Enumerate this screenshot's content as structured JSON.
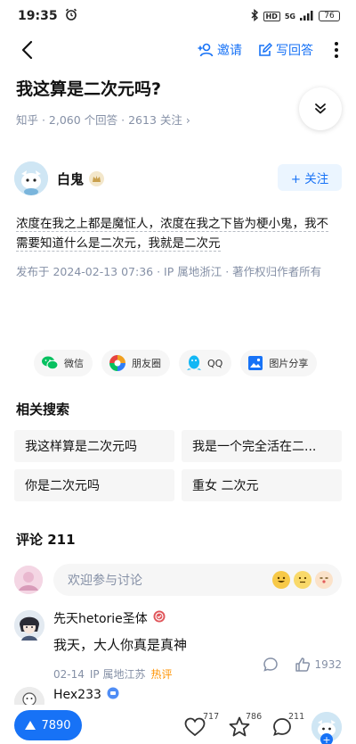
{
  "status_bar": {
    "time": "19:35",
    "network": "5G",
    "battery": "76",
    "hd": "HD"
  },
  "nav": {
    "invite_label": "邀请",
    "write_answer_label": "写回答"
  },
  "question": {
    "title": "我这算是二次元吗?",
    "meta": "知乎 · 2,060 个回答 · 2613 关注 ›"
  },
  "answer": {
    "author_name": "白鬼",
    "follow_label": "+ 关注",
    "content": "浓度在我之上都是魔怔人，浓度在我之下皆为梗小鬼，我不需要知道什么是二次元，我就是二次元",
    "meta": "发布于 2024-02-13 07:36 · IP 属地浙江 · 著作权归作者所有"
  },
  "share": [
    {
      "label": "微信",
      "icon": "wechat-icon",
      "color": "#07c160"
    },
    {
      "label": "朋友圈",
      "icon": "moments-icon",
      "color": "#f0a020"
    },
    {
      "label": "QQ",
      "icon": "qq-icon",
      "color": "#12b7f5"
    },
    {
      "label": "图片分享",
      "icon": "image-share-icon",
      "color": "#1772f6"
    }
  ],
  "related": {
    "title": "相关搜索",
    "items": [
      "我这样算是二次元吗",
      "我是一个完全活在二...",
      "你是二次元吗",
      "重女 二次元"
    ]
  },
  "comments": {
    "title": "评论 211",
    "placeholder": "欢迎参与讨论",
    "items": [
      {
        "name": "先天hetorie圣体",
        "text": "我天，大人你真是真神",
        "date": "02-14",
        "ip": "IP 属地江苏",
        "tag": "热评",
        "likes": "1932"
      },
      {
        "name": "Hex233"
      }
    ]
  },
  "bottom_bar": {
    "vote_count": "7890",
    "like_count": "717",
    "star_count": "786",
    "comment_count": "211"
  },
  "colors": {
    "accent": "#1772f6",
    "meta_gray": "#8590a6",
    "hot": "#ff9607"
  }
}
